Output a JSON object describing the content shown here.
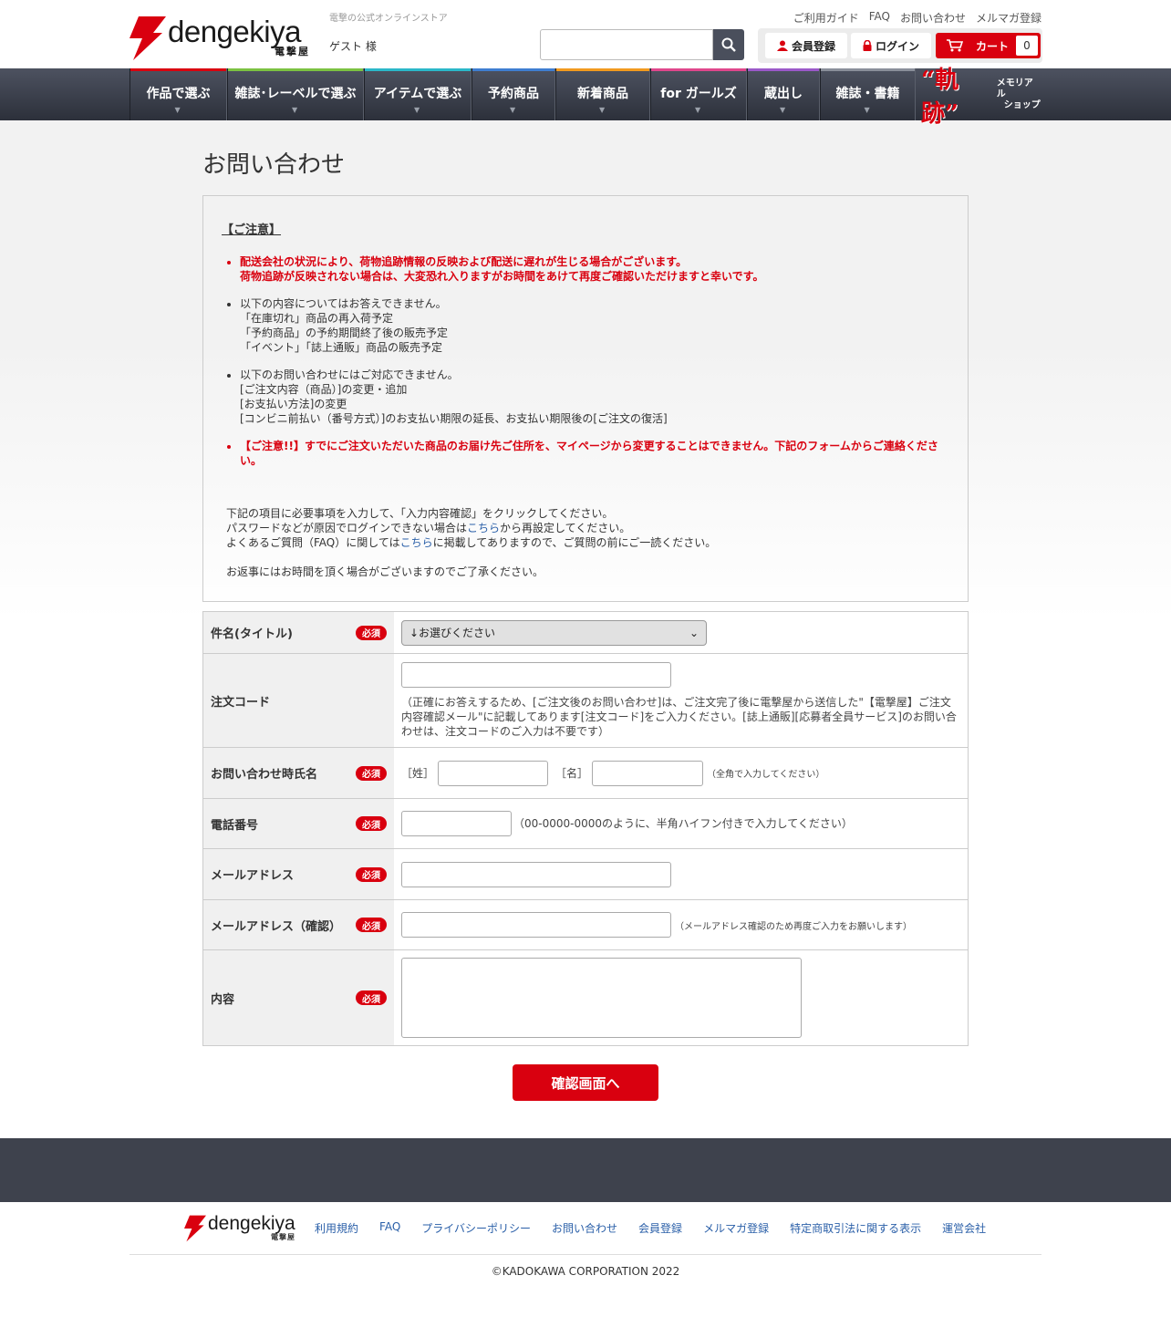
{
  "header": {
    "logo_text": "dengekiya",
    "logo_kanji": "電撃屋",
    "tagline": "電撃の公式オンラインストア",
    "guest": "ゲスト 様",
    "util_links": [
      "ご利用ガイド",
      "FAQ",
      "お問い合わせ",
      "メルマガ登録"
    ],
    "search_placeholder": "",
    "member_label": "会員登録",
    "login_label": "ログイン",
    "cart_label": "カート",
    "cart_count": "0"
  },
  "nav": {
    "items": [
      {
        "label": "作品で選ぶ",
        "color": "#d9000f"
      },
      {
        "label": "雑誌･レーベルで選ぶ",
        "color": "#7cc242"
      },
      {
        "label": "アイテムで選ぶ",
        "color": "#2bb8c9"
      },
      {
        "label": "予約商品",
        "color": "#3f7ed1"
      },
      {
        "label": "新着商品",
        "color": "#f29a1f"
      },
      {
        "label": "for ガールズ",
        "color": "#e0478c"
      },
      {
        "label": "蔵出し",
        "color": "#9b59c9"
      },
      {
        "label": "雑誌・書籍",
        "color": "#8a8f9a"
      }
    ],
    "kiseki_title": "“軌跡”",
    "kiseki_sub1": "メモリアル",
    "kiseki_sub2": "ショップ"
  },
  "page_title": "お問い合わせ",
  "notice": {
    "heading": "【ご注意】",
    "items": [
      {
        "lines": [
          "配送会社の状況により、荷物追跡情報の反映および配送に遅れが生じる場合がございます。",
          "荷物追跡が反映されない場合は、大変恐れ入りますがお時間をあけて再度ご確認いただけますと幸いです。"
        ]
      },
      {
        "lines": [
          "以下の内容についてはお答えできません。",
          "「在庫切れ」商品の再入荷予定",
          "「予約商品」の予約期間終了後の販売予定",
          "「イベント」「誌上通販」商品の販売予定"
        ]
      },
      {
        "lines": [
          "以下のお問い合わせにはご対応できません。",
          "[ご注文内容（商品）]の変更・追加",
          "[お支払い方法]の変更",
          "[コンビニ前払い（番号方式）]のお支払い期限の延長、お支払い期限後の[ご注文の復活]"
        ]
      },
      {
        "lines": [
          "【ご注意!!】すでにご注文いただいた商品のお届け先ご住所を、マイページから変更することはできません。下記のフォームからご連絡くださ",
          "い。"
        ]
      }
    ],
    "tail1": "下記の項目に必要事項を入力して、「入力内容確認」をクリックしてください。",
    "tail2a": "パスワードなどが原因でログインできない場合は",
    "tail2link": "こちら",
    "tail2b": "から再設定してください。",
    "tail3a": "よくあるご質問（FAQ）に関しては",
    "tail3link": "こちら",
    "tail3b": "に掲載してありますので、ご質問の前にご一読ください。",
    "tail4": "お返事にはお時間を頂く場合がございますのでご了承ください。"
  },
  "form": {
    "required_badge": "必須",
    "subject_label": "件名(タイトル)",
    "subject_selected": "↓お選びください",
    "order_label": "注文コード",
    "order_hint": "（正確にお答えするため、[ご注文後のお問い合わせ]は、ご注文完了後に電撃屋から送信した\"【電撃屋】ご注文内容確認メール\"に記載してあります[注文コード]をご入力ください。[誌上通販][応募者全員サービス]のお問い合わせは、注文コードのご入力は不要です）",
    "name_label": "お問い合わせ時氏名",
    "sei": "［姓］",
    "mei": "［名］",
    "name_hint": "（全角で入力してください）",
    "phone_label": "電話番号",
    "phone_hint": "（00-0000-0000のように、半角ハイフン付きで入力してください）",
    "email_label": "メールアドレス",
    "email2_label": "メールアドレス（確認）",
    "email2_hint": "（メールアドレス確認のため再度ご入力をお願いします）",
    "content_label": "内容",
    "submit": "確認画面へ"
  },
  "footer": {
    "logo_text": "dengekiya",
    "logo_kanji": "電撃屋",
    "links": [
      "利用規約",
      "FAQ",
      "プライバシーポリシー",
      "お問い合わせ",
      "会員登録",
      "メルマガ登録",
      "特定商取引法に関する表示",
      "運営会社"
    ],
    "copyright": "©KADOKAWA CORPORATION 2022"
  }
}
